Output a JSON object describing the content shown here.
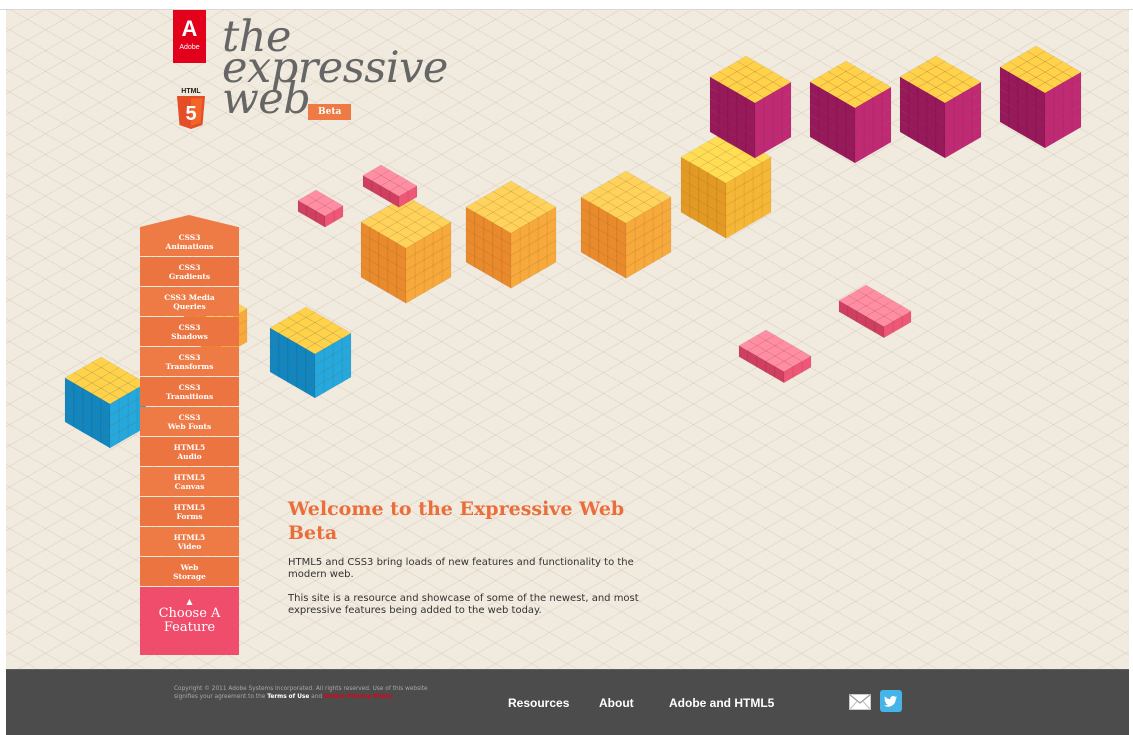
{
  "brand": {
    "adobe_mark": "Adobe",
    "title_lines": [
      "the",
      "expressive",
      "web"
    ],
    "beta_label": "Beta",
    "html5_mark": "HTML 5"
  },
  "sidebar": {
    "items": [
      {
        "label": "CSS3\nAnimations"
      },
      {
        "label": "CSS3\nGradients"
      },
      {
        "label": "CSS3 Media\nQueries"
      },
      {
        "label": "CSS3\nShadows"
      },
      {
        "label": "CSS3\nTransforms"
      },
      {
        "label": "CSS3\nTransitions"
      },
      {
        "label": "CSS3\nWeb Fonts"
      },
      {
        "label": "HTML5\nAudio"
      },
      {
        "label": "HTML5\nCanvas"
      },
      {
        "label": "HTML5\nForms"
      },
      {
        "label": "HTML5\nVideo"
      },
      {
        "label": "Web\nStorage"
      }
    ],
    "choose_label": "Choose A Feature"
  },
  "welcome": {
    "heading": "Welcome to the Expressive Web Beta",
    "paragraph1": "HTML5 and CSS3 bring loads of new features and functionality to the modern web.",
    "paragraph2": "This site is a resource and showcase of some of the newest, and most expressive features being added to the web today."
  },
  "footer": {
    "copyright": "Copyright © 2011 Adobe Systems Incorporated. All rights reserved. Use of this website signifies your agreement to the",
    "terms_link": "Terms of Use",
    "and_text": "and",
    "privacy_link": "Online Privacy Policy",
    "nav": [
      "Resources",
      "About",
      "Adobe and HTML5"
    ],
    "icons": [
      "mail-icon",
      "twitter-icon"
    ]
  },
  "colors": {
    "accent": "#ee7b45",
    "choose": "#f04c6b",
    "footer": "#4c4c4c",
    "heading": "#ea6d3a"
  }
}
